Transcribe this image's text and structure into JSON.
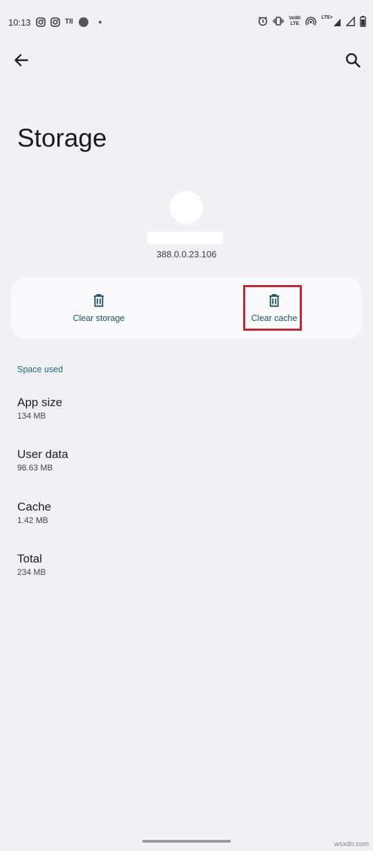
{
  "status_bar": {
    "time": "10:13",
    "left_icons": [
      "instagram-icon",
      "instagram-icon",
      "ti-carrier-icon",
      "record-dot-icon",
      "small-dot-icon"
    ],
    "carrier_text": "TII",
    "volte_text_top": "VoWi",
    "volte_text_bottom": "LTE",
    "lte_text": "LTE+",
    "right_icons": [
      "alarm-icon",
      "vibrate-icon",
      "volte-icon",
      "hotspot-icon",
      "lte-signal-icon",
      "signal-icon",
      "battery-icon"
    ]
  },
  "app_bar": {
    "back_icon": "arrow-back-icon",
    "search_icon": "search-icon"
  },
  "page": {
    "title": "Storage",
    "app_version": "388.0.0.23.106"
  },
  "actions": {
    "clear_storage_label": "Clear storage",
    "clear_cache_label": "Clear cache",
    "icon": "trash-icon",
    "highlight_color": "#cc2129"
  },
  "space_used": {
    "header": "Space used",
    "items": [
      {
        "title": "App size",
        "value": "134 MB"
      },
      {
        "title": "User data",
        "value": "98.63 MB"
      },
      {
        "title": "Cache",
        "value": "1.42 MB"
      },
      {
        "title": "Total",
        "value": "234 MB"
      }
    ]
  },
  "watermark": "wsxdn.com",
  "colors": {
    "background": "#f1f1f5",
    "card": "#f9f9fb",
    "accent": "#196a78",
    "action_text": "#1f5561"
  }
}
